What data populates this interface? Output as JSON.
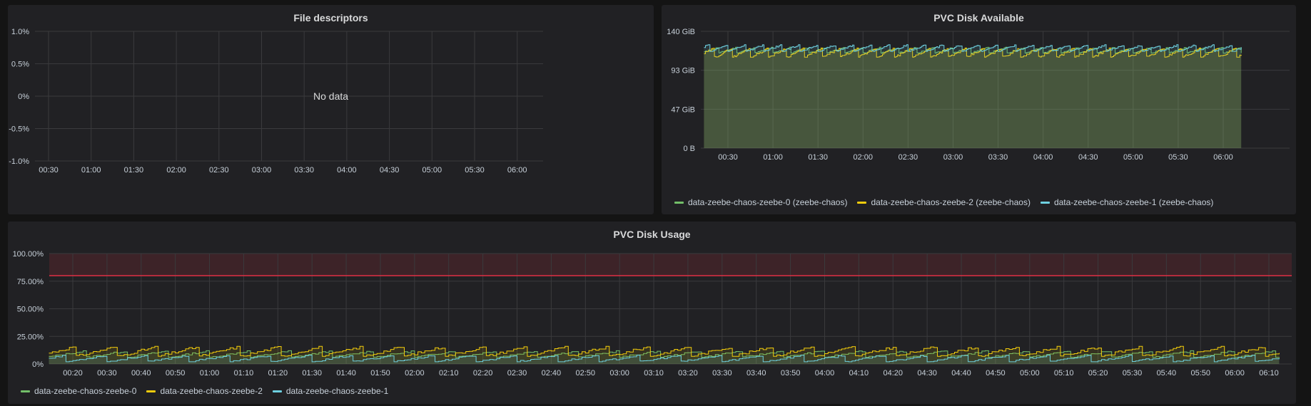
{
  "panels": {
    "file_descriptors": {
      "title": "File descriptors",
      "no_data": "No data"
    },
    "pvc_available": {
      "title": "PVC Disk Available",
      "legend": [
        {
          "label": "data-zeebe-chaos-zeebe-0 (zeebe-chaos)",
          "color": "#73bf69"
        },
        {
          "label": "data-zeebe-chaos-zeebe-2 (zeebe-chaos)",
          "color": "#f2cc0c"
        },
        {
          "label": "data-zeebe-chaos-zeebe-1 (zeebe-chaos)",
          "color": "#6ed0e0"
        }
      ]
    },
    "pvc_usage": {
      "title": "PVC Disk Usage",
      "legend": [
        {
          "label": "data-zeebe-chaos-zeebe-0",
          "color": "#73bf69"
        },
        {
          "label": "data-zeebe-chaos-zeebe-2",
          "color": "#f2cc0c"
        },
        {
          "label": "data-zeebe-chaos-zeebe-1",
          "color": "#6ed0e0"
        }
      ]
    }
  },
  "chart_data": [
    {
      "type": "line",
      "title": "File descriptors",
      "yticks": [
        "1.0%",
        "0.5%",
        "0%",
        "-0.5%",
        "-1.0%"
      ],
      "xticks": [
        "00:30",
        "01:00",
        "01:30",
        "02:00",
        "02:30",
        "03:00",
        "03:30",
        "04:00",
        "04:30",
        "05:00",
        "05:30",
        "06:00"
      ],
      "ylim": [
        -1.0,
        1.0
      ],
      "series": [],
      "annotation": "No data"
    },
    {
      "type": "area",
      "title": "PVC Disk Available",
      "yticks": [
        "140 GiB",
        "93 GiB",
        "47 GiB",
        "0 B"
      ],
      "xticks": [
        "00:30",
        "01:00",
        "01:30",
        "02:00",
        "02:30",
        "03:00",
        "03:30",
        "04:00",
        "04:30",
        "05:00",
        "05:30",
        "06:00"
      ],
      "ylim": [
        0,
        140
      ],
      "x_range": [
        "00:14",
        "06:12"
      ],
      "period_minutes": 12,
      "series": [
        {
          "name": "data-zeebe-chaos-zeebe-0 (zeebe-chaos)",
          "color": "#73bf69",
          "min": 114,
          "max": 121
        },
        {
          "name": "data-zeebe-chaos-zeebe-2 (zeebe-chaos)",
          "color": "#f2cc0c",
          "min": 109,
          "max": 120
        },
        {
          "name": "data-zeebe-chaos-zeebe-1 (zeebe-chaos)",
          "color": "#6ed0e0",
          "min": 116,
          "max": 124
        }
      ]
    },
    {
      "type": "line",
      "title": "PVC Disk Usage",
      "yticks": [
        "100.00%",
        "75.00%",
        "50.00%",
        "25.00%",
        "0%"
      ],
      "xticks": [
        "00:20",
        "00:30",
        "00:40",
        "00:50",
        "01:00",
        "01:10",
        "01:20",
        "01:30",
        "01:40",
        "01:50",
        "02:00",
        "02:10",
        "02:20",
        "02:30",
        "02:40",
        "02:50",
        "03:00",
        "03:10",
        "03:20",
        "03:30",
        "03:40",
        "03:50",
        "04:00",
        "04:10",
        "04:20",
        "04:30",
        "04:40",
        "04:50",
        "05:00",
        "05:10",
        "05:20",
        "05:30",
        "05:40",
        "05:50",
        "06:00",
        "06:10"
      ],
      "ylim": [
        0,
        100
      ],
      "x_range": [
        "00:13",
        "06:13"
      ],
      "threshold": {
        "value": 80,
        "color": "#e02f44"
      },
      "period_minutes": 12,
      "series": [
        {
          "name": "data-zeebe-chaos-zeebe-0",
          "color": "#73bf69",
          "min": 6,
          "max": 12
        },
        {
          "name": "data-zeebe-chaos-zeebe-2",
          "color": "#f2cc0c",
          "min": 7,
          "max": 16
        },
        {
          "name": "data-zeebe-chaos-zeebe-1",
          "color": "#6ed0e0",
          "min": 2,
          "max": 8
        }
      ]
    }
  ]
}
